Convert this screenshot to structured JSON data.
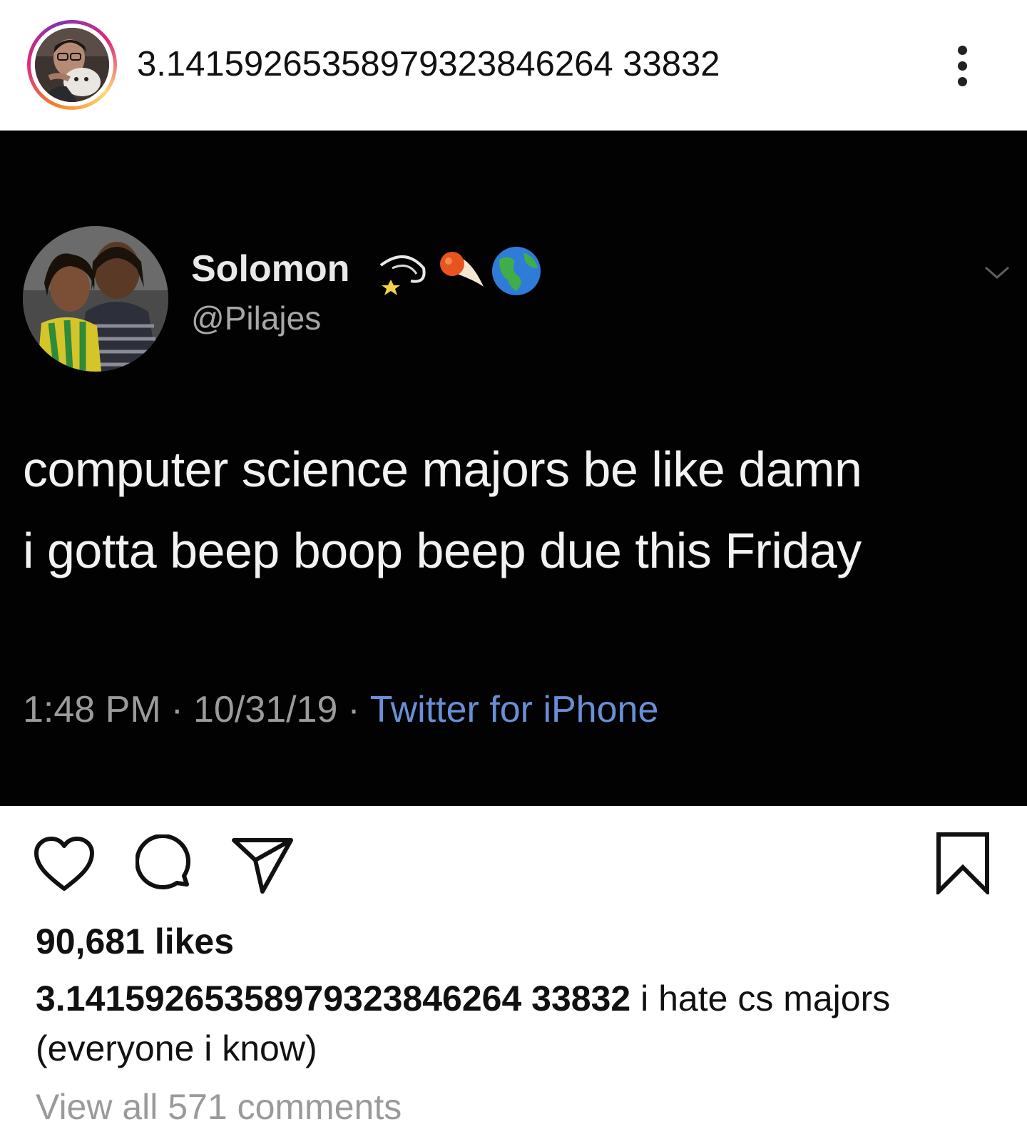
{
  "header": {
    "username": "3.14159265358979323846264 33832",
    "more_icon": "more-vertical-icon"
  },
  "tweet": {
    "display_name": "Solomon",
    "handle": "@Pilajes",
    "text_line1": "computer science majors be like damn",
    "text_line2": "i gotta beep boop beep due this Friday",
    "time": "1:48 PM",
    "date": "10/31/19",
    "separator": "·",
    "source": "Twitter for iPhone",
    "emojis": [
      "dizzy-icon",
      "comet-icon",
      "earth-globe-icon"
    ],
    "menu_icon": "chevron-down-icon",
    "colors": {
      "background": "#020202",
      "text": "#f2f2f2",
      "meta": "#9b9b9b",
      "source_link": "#6a8fd6"
    }
  },
  "actions": {
    "like_icon": "heart-icon",
    "comment_icon": "comment-bubble-icon",
    "share_icon": "paper-plane-icon",
    "save_icon": "bookmark-icon"
  },
  "likes": "90,681 likes",
  "caption": {
    "username": "3.14159265358979323846264 33832",
    "text": " i hate cs majors (everyone i know)"
  },
  "view_comments": "View all 571 comments"
}
